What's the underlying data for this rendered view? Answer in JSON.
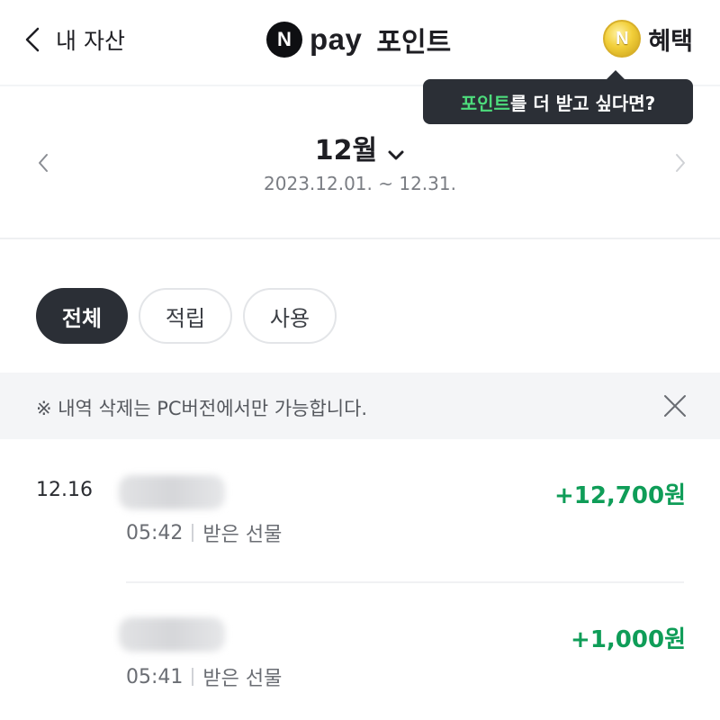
{
  "header": {
    "back_label": "내 자산",
    "brand_badge": "N",
    "brand_pay": "pay",
    "brand_title": "포인트",
    "benefit_label": "혜택",
    "coin_symbol": "N"
  },
  "tooltip": {
    "highlight": "포인트",
    "rest": "를 더 받고 싶다면?"
  },
  "period": {
    "month": "12월",
    "range": "2023.12.01. ~ 12.31."
  },
  "filters": [
    {
      "label": "전체",
      "selected": true
    },
    {
      "label": "적립",
      "selected": false
    },
    {
      "label": "사용",
      "selected": false
    }
  ],
  "notice": {
    "text": "※ 내역 삭제는 PC버전에서만 가능합니다."
  },
  "transactions": [
    {
      "date": "12.16",
      "time": "05:42",
      "type": "받은 선물",
      "amount": "+12,700원"
    },
    {
      "date": "",
      "time": "05:41",
      "type": "받은 선물",
      "amount": "+1,000원"
    }
  ],
  "colors": {
    "accent_green": "#0f9d58",
    "tooltip_highlight": "#4ddc7c",
    "dark": "#2b2f36"
  }
}
